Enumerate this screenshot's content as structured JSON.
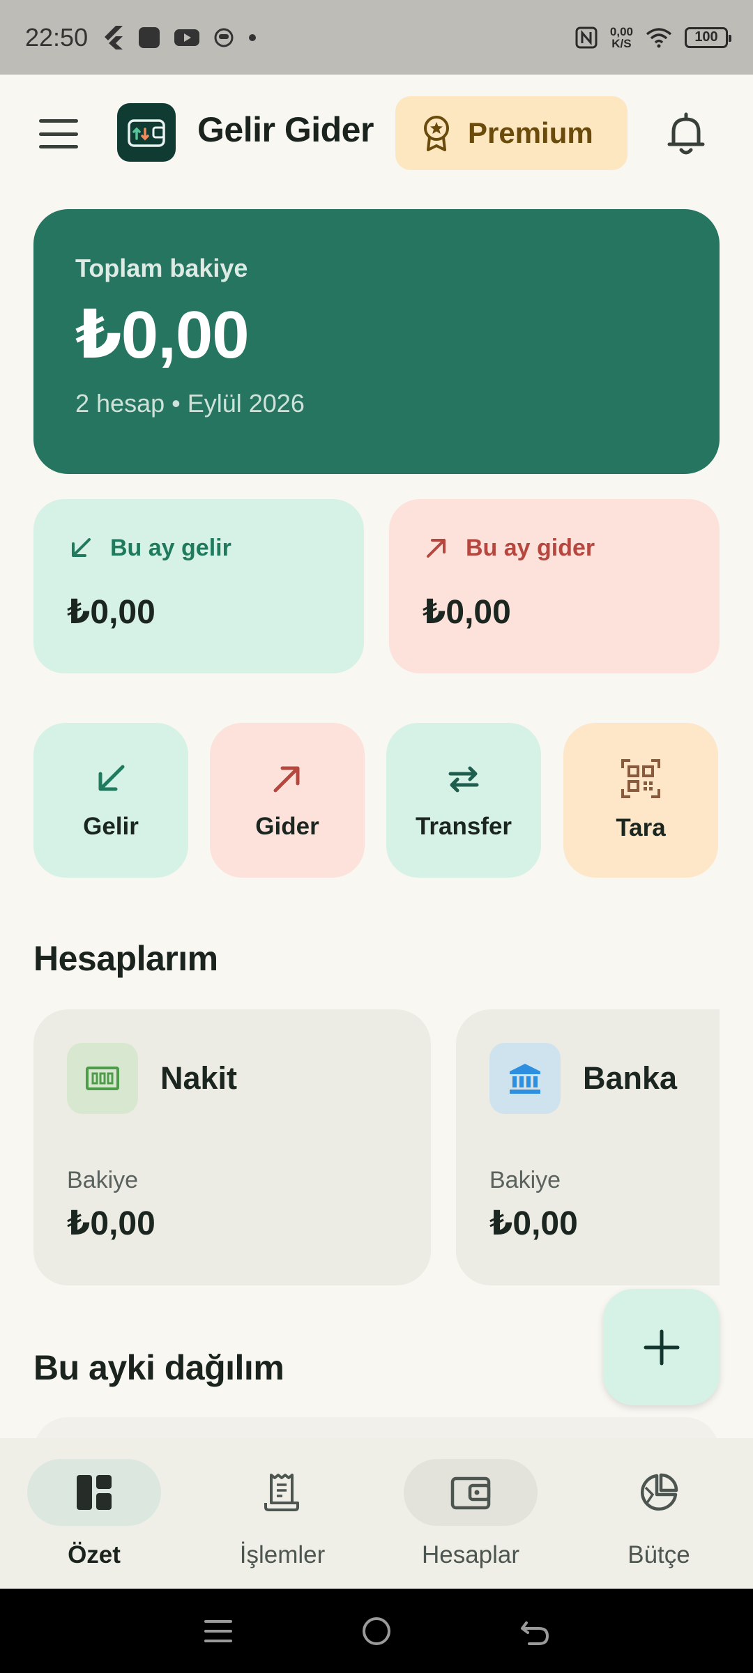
{
  "status_bar": {
    "time": "22:50",
    "speed_value": "0,00",
    "speed_unit": "K/S",
    "battery": "100"
  },
  "app_bar": {
    "title": "Gelir Gider",
    "premium_label": "Premium"
  },
  "balance": {
    "label": "Toplam bakiye",
    "amount": "₺0,00",
    "meta": "2 hesap • Eylül 2026"
  },
  "month": {
    "income_label": "Bu ay gelir",
    "income_amount": "₺0,00",
    "expense_label": "Bu ay gider",
    "expense_amount": "₺0,00"
  },
  "quick_actions": {
    "income": "Gelir",
    "expense": "Gider",
    "transfer": "Transfer",
    "scan": "Tara"
  },
  "accounts": {
    "title": "Hesaplarım",
    "items": [
      {
        "name": "Nakit",
        "balance_label": "Bakiye",
        "balance": "₺0,00"
      },
      {
        "name": "Banka",
        "balance_label": "Bakiye",
        "balance": "₺0,00"
      }
    ]
  },
  "distribution": {
    "title": "Bu ayki dağılım"
  },
  "nav": {
    "summary": "Özet",
    "transactions": "İşlemler",
    "accounts": "Hesaplar",
    "budget": "Bütçe"
  },
  "colors": {
    "primary": "#267561",
    "income_bg": "#D6F2E6",
    "expense_bg": "#FDE2DB",
    "premium_bg": "#FDE7C0",
    "expense_accent": "#B5473F",
    "income_accent": "#1F7A5E"
  }
}
